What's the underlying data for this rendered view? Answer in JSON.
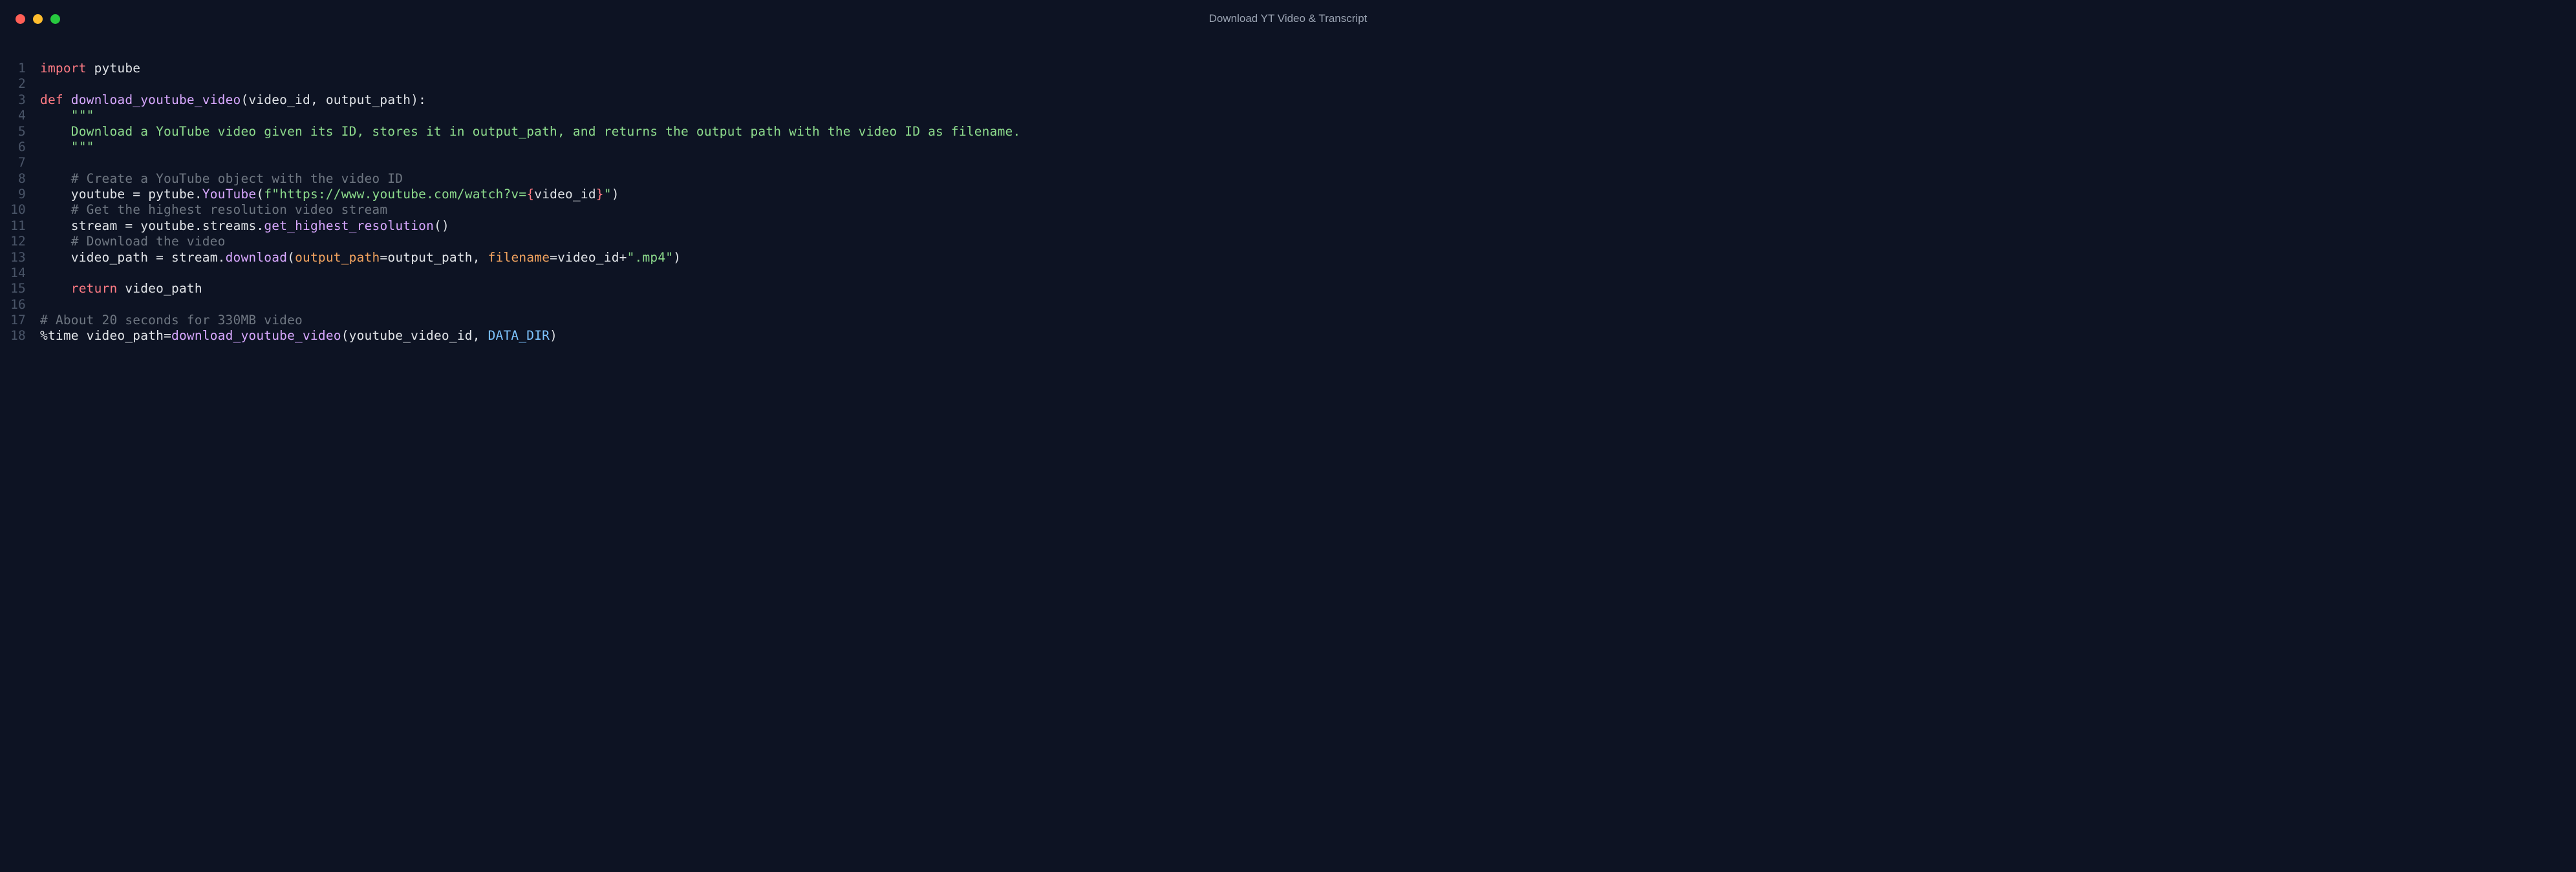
{
  "window": {
    "title": "Download YT Video & Transcript"
  },
  "lines": [
    {
      "n": "1",
      "tokens": [
        {
          "c": "tk-kw",
          "t": "import"
        },
        {
          "c": "tk-op",
          "t": " "
        },
        {
          "c": "tk-id",
          "t": "pytube"
        }
      ]
    },
    {
      "n": "2",
      "tokens": []
    },
    {
      "n": "3",
      "tokens": [
        {
          "c": "tk-kw",
          "t": "def"
        },
        {
          "c": "tk-op",
          "t": " "
        },
        {
          "c": "tk-def",
          "t": "download_youtube_video"
        },
        {
          "c": "tk-op",
          "t": "("
        },
        {
          "c": "tk-id",
          "t": "video_id"
        },
        {
          "c": "tk-op",
          "t": ", "
        },
        {
          "c": "tk-id",
          "t": "output_path"
        },
        {
          "c": "tk-op",
          "t": "):"
        }
      ]
    },
    {
      "n": "4",
      "tokens": [
        {
          "c": "tk-op",
          "t": "    "
        },
        {
          "c": "tk-str",
          "t": "\"\"\""
        }
      ]
    },
    {
      "n": "5",
      "tokens": [
        {
          "c": "tk-op",
          "t": "    "
        },
        {
          "c": "tk-doc",
          "t": "Download a YouTube video given its ID, stores it in output_path, and returns the output path with the video ID as filename."
        }
      ]
    },
    {
      "n": "6",
      "tokens": [
        {
          "c": "tk-op",
          "t": "    "
        },
        {
          "c": "tk-str",
          "t": "\"\"\""
        }
      ]
    },
    {
      "n": "7",
      "tokens": []
    },
    {
      "n": "8",
      "tokens": [
        {
          "c": "tk-op",
          "t": "    "
        },
        {
          "c": "tk-com",
          "t": "# Create a YouTube object with the video ID"
        }
      ]
    },
    {
      "n": "9",
      "tokens": [
        {
          "c": "tk-op",
          "t": "    "
        },
        {
          "c": "tk-id",
          "t": "youtube "
        },
        {
          "c": "tk-op",
          "t": "="
        },
        {
          "c": "tk-op",
          "t": " "
        },
        {
          "c": "tk-id",
          "t": "pytube"
        },
        {
          "c": "tk-op",
          "t": "."
        },
        {
          "c": "tk-fn",
          "t": "YouTube"
        },
        {
          "c": "tk-op",
          "t": "("
        },
        {
          "c": "tk-str",
          "t": "f\"https://www.youtube.com/watch?v="
        },
        {
          "c": "tk-brace",
          "t": "{"
        },
        {
          "c": "tk-interp",
          "t": "video_id"
        },
        {
          "c": "tk-brace",
          "t": "}"
        },
        {
          "c": "tk-str",
          "t": "\""
        },
        {
          "c": "tk-op",
          "t": ")"
        }
      ]
    },
    {
      "n": "10",
      "tokens": [
        {
          "c": "tk-op",
          "t": "    "
        },
        {
          "c": "tk-com",
          "t": "# Get the highest resolution video stream"
        }
      ]
    },
    {
      "n": "11",
      "tokens": [
        {
          "c": "tk-op",
          "t": "    "
        },
        {
          "c": "tk-id",
          "t": "stream "
        },
        {
          "c": "tk-op",
          "t": "="
        },
        {
          "c": "tk-op",
          "t": " "
        },
        {
          "c": "tk-id",
          "t": "youtube"
        },
        {
          "c": "tk-op",
          "t": "."
        },
        {
          "c": "tk-id",
          "t": "streams"
        },
        {
          "c": "tk-op",
          "t": "."
        },
        {
          "c": "tk-fn",
          "t": "get_highest_resolution"
        },
        {
          "c": "tk-op",
          "t": "()"
        }
      ]
    },
    {
      "n": "12",
      "tokens": [
        {
          "c": "tk-op",
          "t": "    "
        },
        {
          "c": "tk-com",
          "t": "# Download the video"
        }
      ]
    },
    {
      "n": "13",
      "tokens": [
        {
          "c": "tk-op",
          "t": "    "
        },
        {
          "c": "tk-id",
          "t": "video_path "
        },
        {
          "c": "tk-op",
          "t": "="
        },
        {
          "c": "tk-op",
          "t": " "
        },
        {
          "c": "tk-id",
          "t": "stream"
        },
        {
          "c": "tk-op",
          "t": "."
        },
        {
          "c": "tk-fn",
          "t": "download"
        },
        {
          "c": "tk-op",
          "t": "("
        },
        {
          "c": "tk-param",
          "t": "output_path"
        },
        {
          "c": "tk-op",
          "t": "="
        },
        {
          "c": "tk-id",
          "t": "output_path"
        },
        {
          "c": "tk-op",
          "t": ", "
        },
        {
          "c": "tk-param",
          "t": "filename"
        },
        {
          "c": "tk-op",
          "t": "="
        },
        {
          "c": "tk-id",
          "t": "video_id"
        },
        {
          "c": "tk-op",
          "t": "+"
        },
        {
          "c": "tk-str",
          "t": "\".mp4\""
        },
        {
          "c": "tk-op",
          "t": ")"
        }
      ]
    },
    {
      "n": "14",
      "tokens": []
    },
    {
      "n": "15",
      "tokens": [
        {
          "c": "tk-op",
          "t": "    "
        },
        {
          "c": "tk-kw",
          "t": "return"
        },
        {
          "c": "tk-op",
          "t": " "
        },
        {
          "c": "tk-id",
          "t": "video_path"
        }
      ]
    },
    {
      "n": "16",
      "tokens": []
    },
    {
      "n": "17",
      "tokens": [
        {
          "c": "tk-com",
          "t": "# About 20 seconds for 330MB video"
        }
      ]
    },
    {
      "n": "18",
      "tokens": [
        {
          "c": "tk-op",
          "t": "%"
        },
        {
          "c": "tk-id",
          "t": "time video_path"
        },
        {
          "c": "tk-op",
          "t": "="
        },
        {
          "c": "tk-fn",
          "t": "download_youtube_video"
        },
        {
          "c": "tk-op",
          "t": "("
        },
        {
          "c": "tk-id",
          "t": "youtube_video_id"
        },
        {
          "c": "tk-op",
          "t": ", "
        },
        {
          "c": "tk-var",
          "t": "DATA_DIR"
        },
        {
          "c": "tk-op",
          "t": ")"
        }
      ]
    }
  ]
}
